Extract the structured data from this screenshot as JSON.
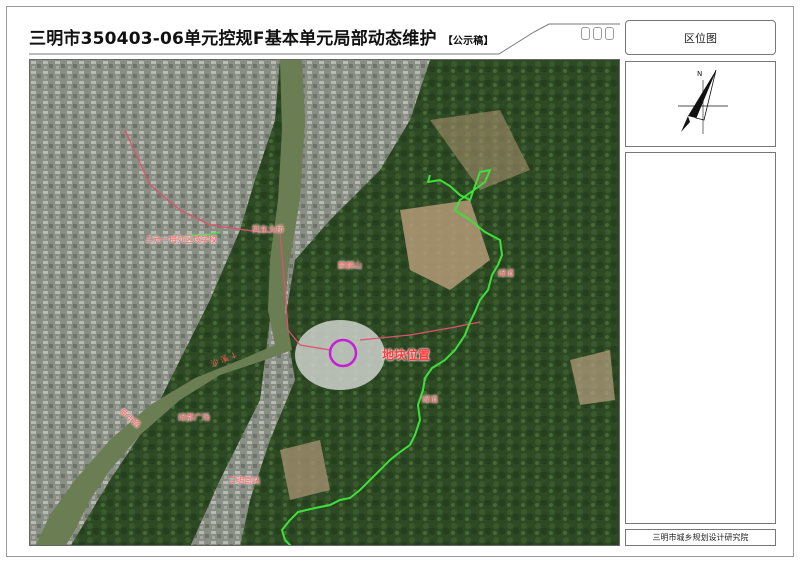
{
  "header": {
    "title": "三明市350403-06单元控规F基本单元局部动态维护",
    "subtitle": "【公示稿】"
  },
  "side": {
    "location_map_label": "区位图",
    "institute": "三明市城乡规划设计研究院"
  },
  "compass": {
    "north_label": "N"
  },
  "map_labels": {
    "north_school": "三元一梅列区域学校",
    "bridge": "列东大桥",
    "hill": "麒麟山",
    "river": "沙 溪 ↓",
    "plot": "地块位置",
    "trail_upper": "绿道",
    "trail_lower": "绿道",
    "road_left": "新市路",
    "square": "绿都广场",
    "station": "三明南站"
  },
  "colors": {
    "boundary_red": "#e0506e",
    "greenway": "#3fe03a",
    "site_circle": "#c61fd6",
    "river": "#6b7d53"
  }
}
